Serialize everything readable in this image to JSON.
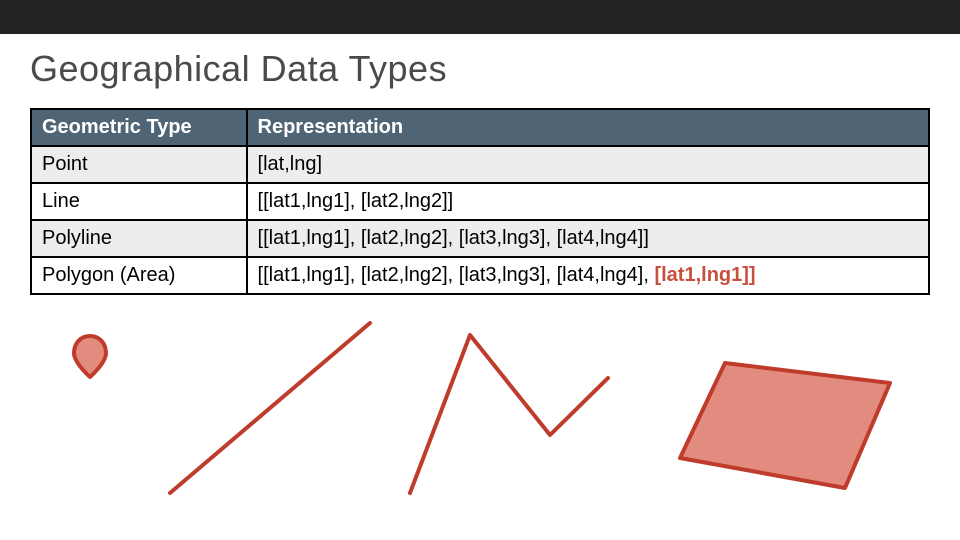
{
  "title": "Geographical Data Types",
  "headers": {
    "c1": "Geometric Type",
    "c2": "Representation"
  },
  "rows": [
    {
      "type": "Point",
      "repr": "[lat,lng]"
    },
    {
      "type": "Line",
      "repr": "[[lat1,lng1], [lat2,lng2]]"
    },
    {
      "type": "Polyline",
      "repr": "[[lat1,lng1], [lat2,lng2], [lat3,lng3], [lat4,lng4]]"
    },
    {
      "type": "Polygon (Area)",
      "repr": "[[lat1,lng1], [lat2,lng2], [lat3,lng3], [lat4,lng4], ",
      "repr_hl": "[lat1,lng1]]"
    }
  ]
}
